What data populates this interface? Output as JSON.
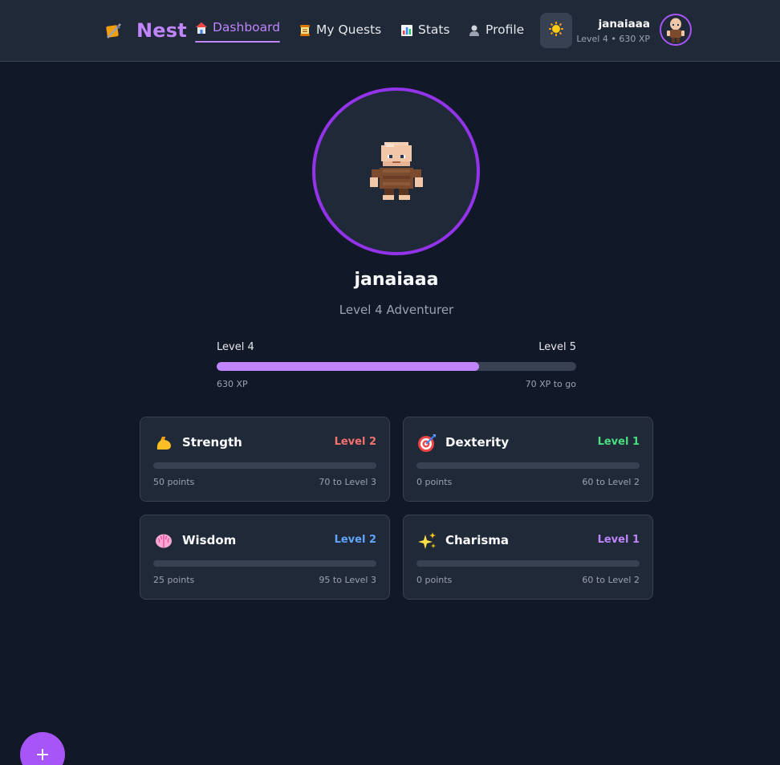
{
  "header": {
    "logo_icon": "sword-quill-icon",
    "app_name": "Nest",
    "nav": [
      {
        "label": "Dashboard",
        "icon": "house-icon",
        "active": true
      },
      {
        "label": "My Quests",
        "icon": "scroll-icon",
        "active": false
      },
      {
        "label": "Stats",
        "icon": "bar-chart-icon",
        "active": false
      },
      {
        "label": "Profile",
        "icon": "user-icon",
        "active": false
      }
    ],
    "theme_icon": "sun-icon",
    "user": {
      "name": "janaiaaa",
      "subtitle": "Level 4 • 630 XP"
    }
  },
  "hero": {
    "name": "janaiaaa",
    "title": "Level 4 Adventurer"
  },
  "xp": {
    "current_level_label": "Level 4",
    "next_level_label": "Level 5",
    "current_xp": "630 XP",
    "remaining": "70 XP to go",
    "progress": 0.73,
    "color": "#c084fc"
  },
  "stats": [
    {
      "name": "Strength",
      "icon": "flexed-bicep-icon",
      "level": "Level 2",
      "level_color": "#f87171",
      "points": "50 points",
      "next": "70 to Level 3",
      "progress": 0.0
    },
    {
      "name": "Dexterity",
      "icon": "target-icon",
      "level": "Level 1",
      "level_color": "#4ade80",
      "points": "0 points",
      "next": "60 to Level 2",
      "progress": 0.0
    },
    {
      "name": "Wisdom",
      "icon": "brain-icon",
      "level": "Level 2",
      "level_color": "#60a5fa",
      "points": "25 points",
      "next": "95 to Level 3",
      "progress": 0.0
    },
    {
      "name": "Charisma",
      "icon": "sparkles-icon",
      "level": "Level 1",
      "level_color": "#c084fc",
      "points": "0 points",
      "next": "60 to Level 2",
      "progress": 0.0
    }
  ],
  "fab": {
    "label": "+"
  },
  "colors": {
    "accent": "#a855f7",
    "background": "#111827",
    "card": "#1f2937"
  }
}
